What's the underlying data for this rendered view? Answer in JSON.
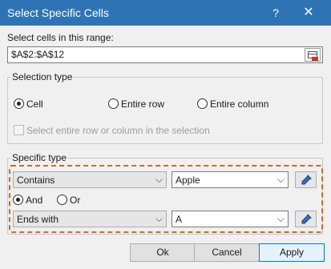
{
  "window": {
    "title": "Select Specific Cells",
    "help_glyph": "?",
    "close_glyph": "✕"
  },
  "range": {
    "label": "Select cells in this range:",
    "value": "$A$2:$A$12"
  },
  "selection_type": {
    "legend": "Selection type",
    "options": [
      "Cell",
      "Entire row",
      "Entire column"
    ],
    "selected": "Cell",
    "checkbox_label": "Select entire row or column in the selection"
  },
  "specific_type": {
    "legend": "Specific type",
    "condition1": {
      "operator": "Contains",
      "value": "Apple"
    },
    "logic": {
      "and": "And",
      "or": "Or",
      "selected": "And"
    },
    "condition2": {
      "operator": "Ends with",
      "value": "A"
    }
  },
  "buttons": {
    "ok": "Ok",
    "cancel": "Cancel",
    "apply": "Apply"
  },
  "colors": {
    "titlebar": "#2e74b5",
    "highlight_dash": "#d2691e",
    "accent": "#0078d7"
  }
}
